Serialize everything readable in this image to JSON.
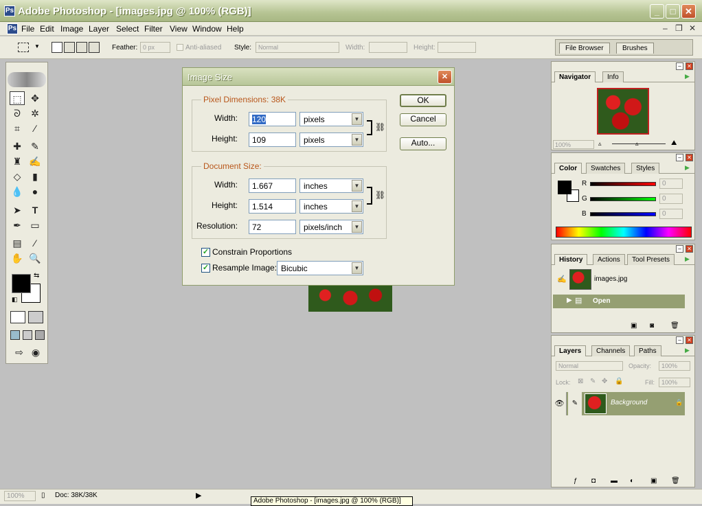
{
  "window": {
    "title": "Adobe Photoshop - [images.jpg @ 100% (RGB)]",
    "app_icon": "photoshop-logo-icon"
  },
  "menu": [
    "File",
    "Edit",
    "Image",
    "Layer",
    "Select",
    "Filter",
    "View",
    "Window",
    "Help"
  ],
  "options": {
    "feather_label": "Feather:",
    "feather_value": "0 px",
    "antialiased_label": "Anti-aliased",
    "style_label": "Style:",
    "style_value": "Normal",
    "width_label": "Width:",
    "height_label": "Height:",
    "tabs": [
      "File Browser",
      "Brushes"
    ]
  },
  "dialog": {
    "title": "Image Size",
    "pixel_dimensions_label": "Pixel Dimensions:  38K",
    "document_size_label": "Document Size:",
    "width_label": "Width:",
    "height_label": "Height:",
    "resolution_label": "Resolution:",
    "px_width": "120",
    "px_width_unit": "pixels",
    "px_height": "109",
    "px_height_unit": "pixels",
    "doc_width": "1.667",
    "doc_width_unit": "inches",
    "doc_height": "1.514",
    "doc_height_unit": "inches",
    "resolution": "72",
    "resolution_unit": "pixels/inch",
    "constrain_label": "Constrain Proportions",
    "constrain_checked": true,
    "resample_label": "Resample Image:",
    "resample_checked": true,
    "resample_value": "Bicubic",
    "ok": "OK",
    "cancel": "Cancel",
    "auto": "Auto..."
  },
  "navigator": {
    "tabs": [
      "Navigator",
      "Info"
    ],
    "zoom": "100%"
  },
  "color": {
    "tabs": [
      "Color",
      "Swatches",
      "Styles"
    ],
    "channels": [
      "R",
      "G",
      "B"
    ],
    "values": [
      "0",
      "0",
      "0"
    ]
  },
  "history": {
    "tabs": [
      "History",
      "Actions",
      "Tool Presets"
    ],
    "snapshot": "images.jpg",
    "state": "Open"
  },
  "layers": {
    "tabs": [
      "Layers",
      "Channels",
      "Paths"
    ],
    "blend": "Normal",
    "opacity_label": "Opacity:",
    "opacity": "100%",
    "lock_label": "Lock:",
    "fill_label": "Fill:",
    "fill": "100%",
    "layer_name": "Background"
  },
  "status": {
    "zoom": "100%",
    "doc": "Doc: 38K/38K"
  },
  "taskbar_tooltip": "Adobe Photoshop - [images.jpg @ 100% (RGB)]",
  "colors": {
    "title_green": "#b6c493",
    "accent_orange": "#b8561a",
    "close_red": "#d04020"
  }
}
